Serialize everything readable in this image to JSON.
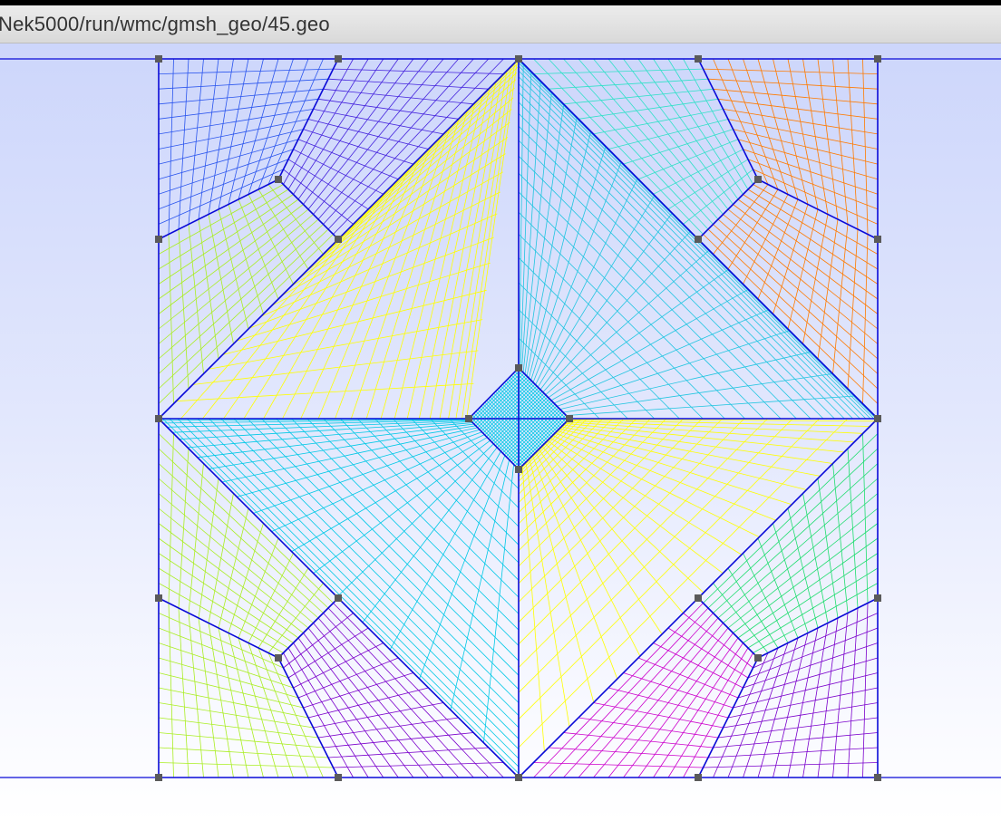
{
  "window": {
    "title": "Nek5000/run/wmc/gmsh_geo/45.geo"
  },
  "colors": {
    "edge": "#0a0ad8",
    "point": "#5a5a5a",
    "viewport_top": "#cdd6fb",
    "viewport_bottom": "#ffffff",
    "mesh_palette": [
      "#2a55ee",
      "#4422dd",
      "#aaee22",
      "#ffff00",
      "#20c5e0",
      "#30e0c8",
      "#ff7a00",
      "#7a00cc",
      "#cc00cc",
      "#20dd70",
      "#00c8e6"
    ]
  },
  "view": {
    "name": "mesh-viewer",
    "scale_line": "horizontal-axis-lines"
  }
}
